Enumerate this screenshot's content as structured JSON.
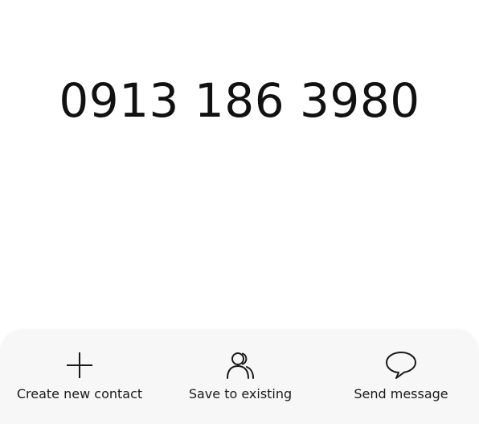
{
  "phone_number": "0913 186 3980",
  "actions": [
    {
      "label": "Create new contact",
      "icon": "plus-icon"
    },
    {
      "label": "Save to existing",
      "icon": "contacts-icon"
    },
    {
      "label": "Send message",
      "icon": "message-bubble-icon"
    }
  ],
  "colors": {
    "background": "#ffffff",
    "panel": "#f7f7f7",
    "text": "#111111"
  }
}
